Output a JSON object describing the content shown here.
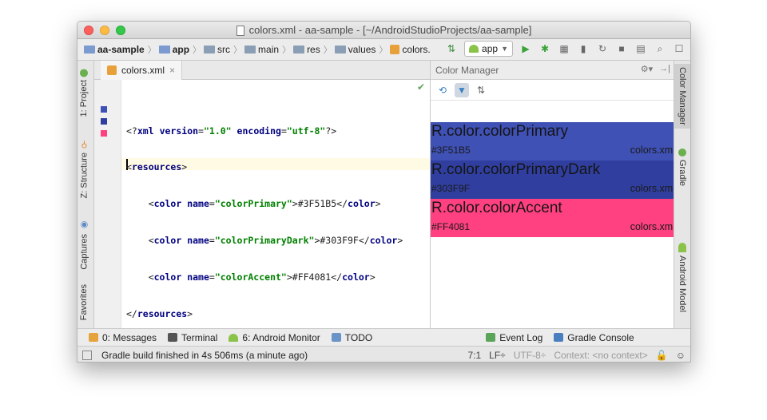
{
  "window": {
    "title": "colors.xml - aa-sample - [~/AndroidStudioProjects/aa-sample]"
  },
  "breadcrumbs": [
    {
      "label": "aa-sample",
      "bold": true
    },
    {
      "label": "app",
      "bold": true
    },
    {
      "label": "src"
    },
    {
      "label": "main"
    },
    {
      "label": "res"
    },
    {
      "label": "values"
    },
    {
      "label": "colors."
    }
  ],
  "toolbar": {
    "run_config": "app",
    "icons": [
      "make-icon",
      "run-icon",
      "debug-icon",
      "attach-icon",
      "apply-changes-icon",
      "sync-icon",
      "stop-icon",
      "sdk-manager-icon",
      "search-icon",
      "profile-icon"
    ]
  },
  "left_tool_windows": {
    "project": "1: Project",
    "structure": "Z: Structure",
    "captures": "Captures",
    "favorites": "Favorites"
  },
  "right_tool_windows": {
    "color_manager": "Color Manager",
    "gradle": "Gradle",
    "android_model": "Android Model"
  },
  "editor": {
    "tab_label": "colors.xml",
    "lines": [
      "<?xml version=\"1.0\" encoding=\"utf-8\"?>",
      "<resources>",
      "    <color name=\"colorPrimary\">#3F51B5</color>",
      "    <color name=\"colorPrimaryDark\">#303F9F</color>",
      "    <color name=\"colorAccent\">#FF4081</color>",
      "</resources>"
    ],
    "gutter_swatches": [
      "#3F51B5",
      "#303F9F",
      "#FF4081"
    ]
  },
  "color_manager": {
    "title": "Color Manager",
    "colors": [
      {
        "name": "R.color.colorPrimary",
        "hex": "#3F51B5",
        "file": "colors.xml",
        "color": "#3F51B5"
      },
      {
        "name": "R.color.colorPrimaryDark",
        "hex": "#303F9F",
        "file": "colors.xml",
        "color": "#303F9F"
      },
      {
        "name": "R.color.colorAccent",
        "hex": "#FF4081",
        "file": "colors.xml",
        "color": "#FF4081"
      }
    ]
  },
  "bottom_tabs": {
    "messages": "0: Messages",
    "terminal": "Terminal",
    "android_monitor": "6: Android Monitor",
    "todo": "TODO",
    "event_log": "Event Log",
    "gradle_console": "Gradle Console"
  },
  "status_bar": {
    "message": "Gradle build finished in 4s 506ms (a minute ago)",
    "position": "7:1",
    "line_separator": "LF÷",
    "encoding": "UTF-8÷",
    "context": "Context: <no context>"
  }
}
